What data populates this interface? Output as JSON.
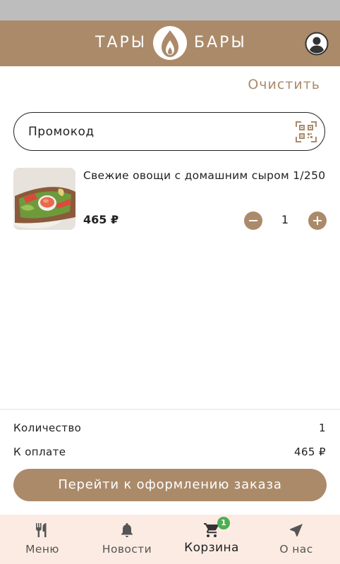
{
  "header": {
    "logo_left": "ТАРЫ",
    "logo_right": "БАРЫ",
    "logo_icon": "flame-logo-icon",
    "profile_icon": "profile-icon"
  },
  "cart": {
    "clear_label": "Очистить",
    "promo": {
      "placeholder": "Промокод",
      "value": ""
    },
    "qr_icon": "qr-code-icon",
    "items": [
      {
        "name": "Свежие овощи с домашним сыром 1/250",
        "price": "465 ₽",
        "quantity": "1"
      }
    ]
  },
  "summary": {
    "quantity_label": "Количество",
    "quantity_value": "1",
    "total_label": "К оплате",
    "total_value": "465 ₽",
    "checkout_label": "Перейти к оформлению заказа"
  },
  "nav": {
    "items": [
      {
        "label": "Меню",
        "icon": "fork-knife-icon"
      },
      {
        "label": "Новости",
        "icon": "bell-icon"
      },
      {
        "label": "Корзина",
        "icon": "cart-icon",
        "badge": "1",
        "active": true
      },
      {
        "label": "О нас",
        "icon": "navigation-arrow-icon"
      }
    ]
  },
  "colors": {
    "accent": "#ab8a6a",
    "nav_bg": "#fcebe3",
    "badge": "#4caf50",
    "status_bar": "#bdbdbd"
  }
}
